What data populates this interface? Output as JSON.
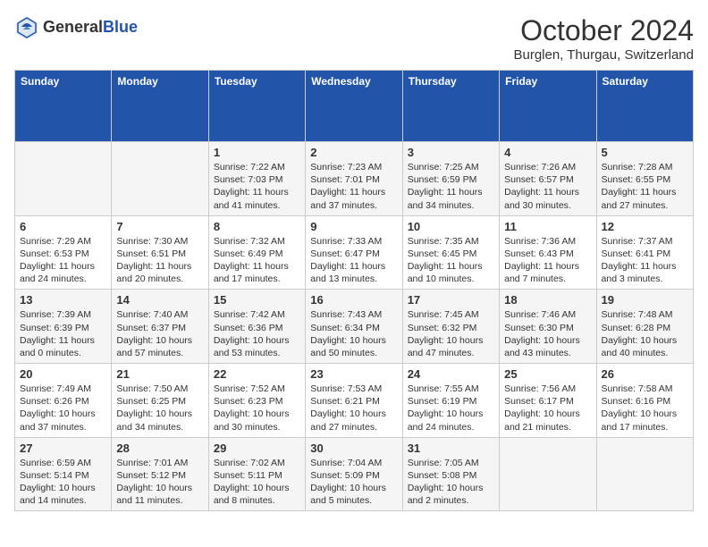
{
  "logo": {
    "text_general": "General",
    "text_blue": "Blue"
  },
  "header": {
    "month_year": "October 2024",
    "location": "Burglen, Thurgau, Switzerland"
  },
  "days_of_week": [
    "Sunday",
    "Monday",
    "Tuesday",
    "Wednesday",
    "Thursday",
    "Friday",
    "Saturday"
  ],
  "weeks": [
    [
      {
        "date": "",
        "text": ""
      },
      {
        "date": "",
        "text": ""
      },
      {
        "date": "1",
        "text": "Sunrise: 7:22 AM\nSunset: 7:03 PM\nDaylight: 11 hours and 41 minutes."
      },
      {
        "date": "2",
        "text": "Sunrise: 7:23 AM\nSunset: 7:01 PM\nDaylight: 11 hours and 37 minutes."
      },
      {
        "date": "3",
        "text": "Sunrise: 7:25 AM\nSunset: 6:59 PM\nDaylight: 11 hours and 34 minutes."
      },
      {
        "date": "4",
        "text": "Sunrise: 7:26 AM\nSunset: 6:57 PM\nDaylight: 11 hours and 30 minutes."
      },
      {
        "date": "5",
        "text": "Sunrise: 7:28 AM\nSunset: 6:55 PM\nDaylight: 11 hours and 27 minutes."
      }
    ],
    [
      {
        "date": "6",
        "text": "Sunrise: 7:29 AM\nSunset: 6:53 PM\nDaylight: 11 hours and 24 minutes."
      },
      {
        "date": "7",
        "text": "Sunrise: 7:30 AM\nSunset: 6:51 PM\nDaylight: 11 hours and 20 minutes."
      },
      {
        "date": "8",
        "text": "Sunrise: 7:32 AM\nSunset: 6:49 PM\nDaylight: 11 hours and 17 minutes."
      },
      {
        "date": "9",
        "text": "Sunrise: 7:33 AM\nSunset: 6:47 PM\nDaylight: 11 hours and 13 minutes."
      },
      {
        "date": "10",
        "text": "Sunrise: 7:35 AM\nSunset: 6:45 PM\nDaylight: 11 hours and 10 minutes."
      },
      {
        "date": "11",
        "text": "Sunrise: 7:36 AM\nSunset: 6:43 PM\nDaylight: 11 hours and 7 minutes."
      },
      {
        "date": "12",
        "text": "Sunrise: 7:37 AM\nSunset: 6:41 PM\nDaylight: 11 hours and 3 minutes."
      }
    ],
    [
      {
        "date": "13",
        "text": "Sunrise: 7:39 AM\nSunset: 6:39 PM\nDaylight: 11 hours and 0 minutes."
      },
      {
        "date": "14",
        "text": "Sunrise: 7:40 AM\nSunset: 6:37 PM\nDaylight: 10 hours and 57 minutes."
      },
      {
        "date": "15",
        "text": "Sunrise: 7:42 AM\nSunset: 6:36 PM\nDaylight: 10 hours and 53 minutes."
      },
      {
        "date": "16",
        "text": "Sunrise: 7:43 AM\nSunset: 6:34 PM\nDaylight: 10 hours and 50 minutes."
      },
      {
        "date": "17",
        "text": "Sunrise: 7:45 AM\nSunset: 6:32 PM\nDaylight: 10 hours and 47 minutes."
      },
      {
        "date": "18",
        "text": "Sunrise: 7:46 AM\nSunset: 6:30 PM\nDaylight: 10 hours and 43 minutes."
      },
      {
        "date": "19",
        "text": "Sunrise: 7:48 AM\nSunset: 6:28 PM\nDaylight: 10 hours and 40 minutes."
      }
    ],
    [
      {
        "date": "20",
        "text": "Sunrise: 7:49 AM\nSunset: 6:26 PM\nDaylight: 10 hours and 37 minutes."
      },
      {
        "date": "21",
        "text": "Sunrise: 7:50 AM\nSunset: 6:25 PM\nDaylight: 10 hours and 34 minutes."
      },
      {
        "date": "22",
        "text": "Sunrise: 7:52 AM\nSunset: 6:23 PM\nDaylight: 10 hours and 30 minutes."
      },
      {
        "date": "23",
        "text": "Sunrise: 7:53 AM\nSunset: 6:21 PM\nDaylight: 10 hours and 27 minutes."
      },
      {
        "date": "24",
        "text": "Sunrise: 7:55 AM\nSunset: 6:19 PM\nDaylight: 10 hours and 24 minutes."
      },
      {
        "date": "25",
        "text": "Sunrise: 7:56 AM\nSunset: 6:17 PM\nDaylight: 10 hours and 21 minutes."
      },
      {
        "date": "26",
        "text": "Sunrise: 7:58 AM\nSunset: 6:16 PM\nDaylight: 10 hours and 17 minutes."
      }
    ],
    [
      {
        "date": "27",
        "text": "Sunrise: 6:59 AM\nSunset: 5:14 PM\nDaylight: 10 hours and 14 minutes."
      },
      {
        "date": "28",
        "text": "Sunrise: 7:01 AM\nSunset: 5:12 PM\nDaylight: 10 hours and 11 minutes."
      },
      {
        "date": "29",
        "text": "Sunrise: 7:02 AM\nSunset: 5:11 PM\nDaylight: 10 hours and 8 minutes."
      },
      {
        "date": "30",
        "text": "Sunrise: 7:04 AM\nSunset: 5:09 PM\nDaylight: 10 hours and 5 minutes."
      },
      {
        "date": "31",
        "text": "Sunrise: 7:05 AM\nSunset: 5:08 PM\nDaylight: 10 hours and 2 minutes."
      },
      {
        "date": "",
        "text": ""
      },
      {
        "date": "",
        "text": ""
      }
    ]
  ]
}
